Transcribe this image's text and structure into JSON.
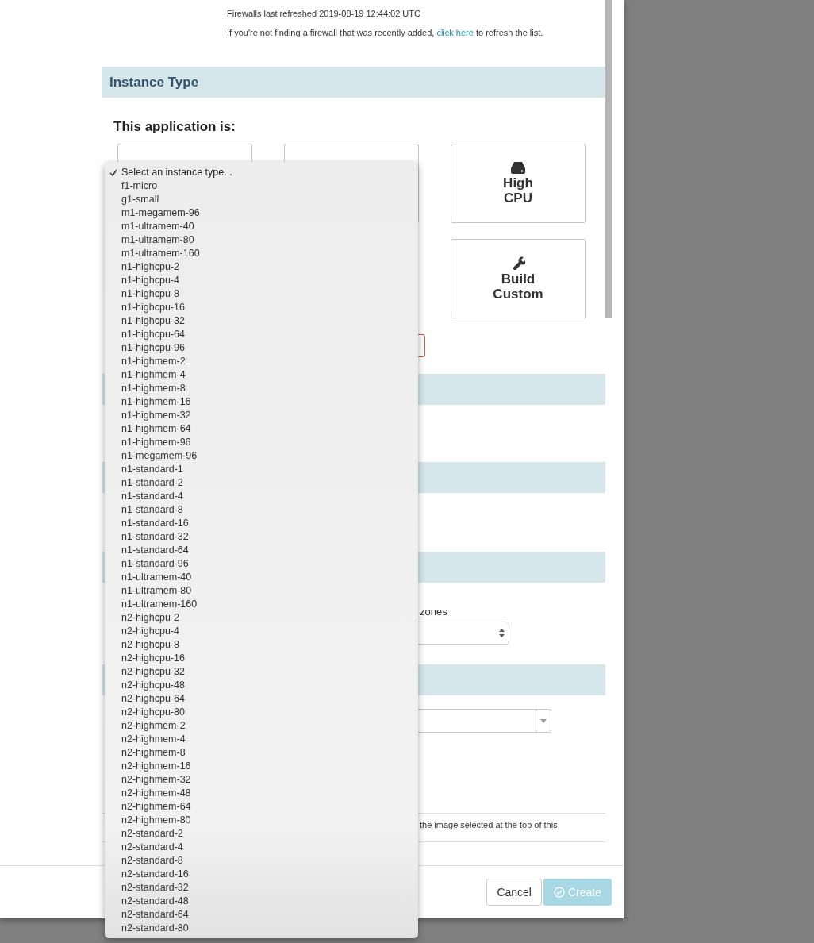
{
  "firewall_notice": {
    "refreshed": "Firewalls last refreshed 2019-08-19 12:44:02 UTC",
    "hint_before": "If you're not finding a firewall that was recently added,",
    "link": "click here",
    "hint_after": "to refresh the list."
  },
  "instance_type": {
    "title": "Instance Type",
    "prompt": "This application is:",
    "cards": [
      {
        "kind": "blank"
      },
      {
        "kind": "blank"
      },
      {
        "kind": "drive",
        "label": "High CPU"
      },
      {
        "kind": "wrench",
        "label": "Build Custom"
      }
    ]
  },
  "sections": [
    {
      "kind": "header"
    },
    {
      "kind": "header"
    },
    {
      "kind": "header"
    }
  ],
  "zones_field": {
    "label": "zones"
  },
  "last_section": {
    "kind": "header"
  },
  "image_note": "the image selected at the top of this",
  "buttons": [
    {
      "label": "Cancel",
      "kind": "plain",
      "disabled": false
    },
    {
      "label": "Create",
      "kind": "primary",
      "disabled": true
    }
  ],
  "instance_dropdown": {
    "options": [
      {
        "label": "Select an instance type...",
        "selected": true
      },
      {
        "label": "f1-micro",
        "selected": false
      },
      {
        "label": "g1-small",
        "selected": false
      },
      {
        "label": "m1-megamem-96",
        "selected": false
      },
      {
        "label": "m1-ultramem-40",
        "selected": false
      },
      {
        "label": "m1-ultramem-80",
        "selected": false
      },
      {
        "label": "m1-ultramem-160",
        "selected": false
      },
      {
        "label": "n1-highcpu-2",
        "selected": false
      },
      {
        "label": "n1-highcpu-4",
        "selected": false
      },
      {
        "label": "n1-highcpu-8",
        "selected": false
      },
      {
        "label": "n1-highcpu-16",
        "selected": false
      },
      {
        "label": "n1-highcpu-32",
        "selected": false
      },
      {
        "label": "n1-highcpu-64",
        "selected": false
      },
      {
        "label": "n1-highcpu-96",
        "selected": false
      },
      {
        "label": "n1-highmem-2",
        "selected": false
      },
      {
        "label": "n1-highmem-4",
        "selected": false
      },
      {
        "label": "n1-highmem-8",
        "selected": false
      },
      {
        "label": "n1-highmem-16",
        "selected": false
      },
      {
        "label": "n1-highmem-32",
        "selected": false
      },
      {
        "label": "n1-highmem-64",
        "selected": false
      },
      {
        "label": "n1-highmem-96",
        "selected": false
      },
      {
        "label": "n1-megamem-96",
        "selected": false
      },
      {
        "label": "n1-standard-1",
        "selected": false
      },
      {
        "label": "n1-standard-2",
        "selected": false
      },
      {
        "label": "n1-standard-4",
        "selected": false
      },
      {
        "label": "n1-standard-8",
        "selected": false
      },
      {
        "label": "n1-standard-16",
        "selected": false
      },
      {
        "label": "n1-standard-32",
        "selected": false
      },
      {
        "label": "n1-standard-64",
        "selected": false
      },
      {
        "label": "n1-standard-96",
        "selected": false
      },
      {
        "label": "n1-ultramem-40",
        "selected": false
      },
      {
        "label": "n1-ultramem-80",
        "selected": false
      },
      {
        "label": "n1-ultramem-160",
        "selected": false
      },
      {
        "label": "n2-highcpu-2",
        "selected": false
      },
      {
        "label": "n2-highcpu-4",
        "selected": false
      },
      {
        "label": "n2-highcpu-8",
        "selected": false
      },
      {
        "label": "n2-highcpu-16",
        "selected": false
      },
      {
        "label": "n2-highcpu-32",
        "selected": false
      },
      {
        "label": "n2-highcpu-48",
        "selected": false
      },
      {
        "label": "n2-highcpu-64",
        "selected": false
      },
      {
        "label": "n2-highcpu-80",
        "selected": false
      },
      {
        "label": "n2-highmem-2",
        "selected": false
      },
      {
        "label": "n2-highmem-4",
        "selected": false
      },
      {
        "label": "n2-highmem-8",
        "selected": false
      },
      {
        "label": "n2-highmem-16",
        "selected": false
      },
      {
        "label": "n2-highmem-32",
        "selected": false
      },
      {
        "label": "n2-highmem-48",
        "selected": false
      },
      {
        "label": "n2-highmem-64",
        "selected": false
      },
      {
        "label": "n2-highmem-80",
        "selected": false
      },
      {
        "label": "n2-standard-2",
        "selected": false
      },
      {
        "label": "n2-standard-4",
        "selected": false
      },
      {
        "label": "n2-standard-8",
        "selected": false
      },
      {
        "label": "n2-standard-16",
        "selected": false
      },
      {
        "label": "n2-standard-32",
        "selected": false
      },
      {
        "label": "n2-standard-48",
        "selected": false
      },
      {
        "label": "n2-standard-64",
        "selected": false
      },
      {
        "label": "n2-standard-80",
        "selected": false
      }
    ]
  }
}
